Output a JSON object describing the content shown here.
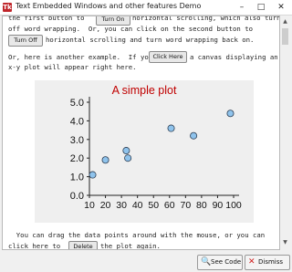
{
  "window": {
    "title": "Text Embedded Windows and other features Demo",
    "app_icon": "Tk",
    "controls": {
      "minimize": "–",
      "maximize": "□",
      "close": "✕"
    }
  },
  "text": {
    "line1_pre": "the first button to",
    "line1_post": "horizontal scrolling, which also turns",
    "line2": "off word wrapping.  Or, you can click on the second button to",
    "line3_post": "horizontal scrolling and turn word wrapping back on.",
    "line4": "Or, here is another example.  If you",
    "line4_post": "a canvas displaying an",
    "line5": "x-y plot will appear right here.",
    "line6": "  You can drag the data points around with the mouse, or you can",
    "line7_pre": "click here to",
    "line7_post": "the plot again."
  },
  "buttons": {
    "turn_on": "Turn On",
    "turn_off": "Turn Off",
    "click_here": "Click Here",
    "delete": "Delete",
    "see_code": "See Code",
    "dismiss": "Dismiss"
  },
  "icons": {
    "see_code": "magnifier-icon",
    "dismiss": "red-x-icon"
  },
  "chart_data": {
    "type": "scatter",
    "title": "A simple plot",
    "title_color": "#c00000",
    "point_color": "#8fc3ec",
    "xlim": [
      10,
      100
    ],
    "ylim": [
      0,
      5
    ],
    "x_ticks": [
      10,
      20,
      30,
      40,
      50,
      60,
      70,
      80,
      90,
      100
    ],
    "y_ticks": [
      "0.0",
      "1.0",
      "2.0",
      "3.0",
      "4.0",
      "5.0"
    ],
    "points": [
      {
        "x": 12,
        "y": 1.1
      },
      {
        "x": 20,
        "y": 1.9
      },
      {
        "x": 33,
        "y": 2.4
      },
      {
        "x": 34,
        "y": 2.0
      },
      {
        "x": 61,
        "y": 3.6
      },
      {
        "x": 75,
        "y": 3.2
      },
      {
        "x": 98,
        "y": 4.4
      }
    ]
  }
}
